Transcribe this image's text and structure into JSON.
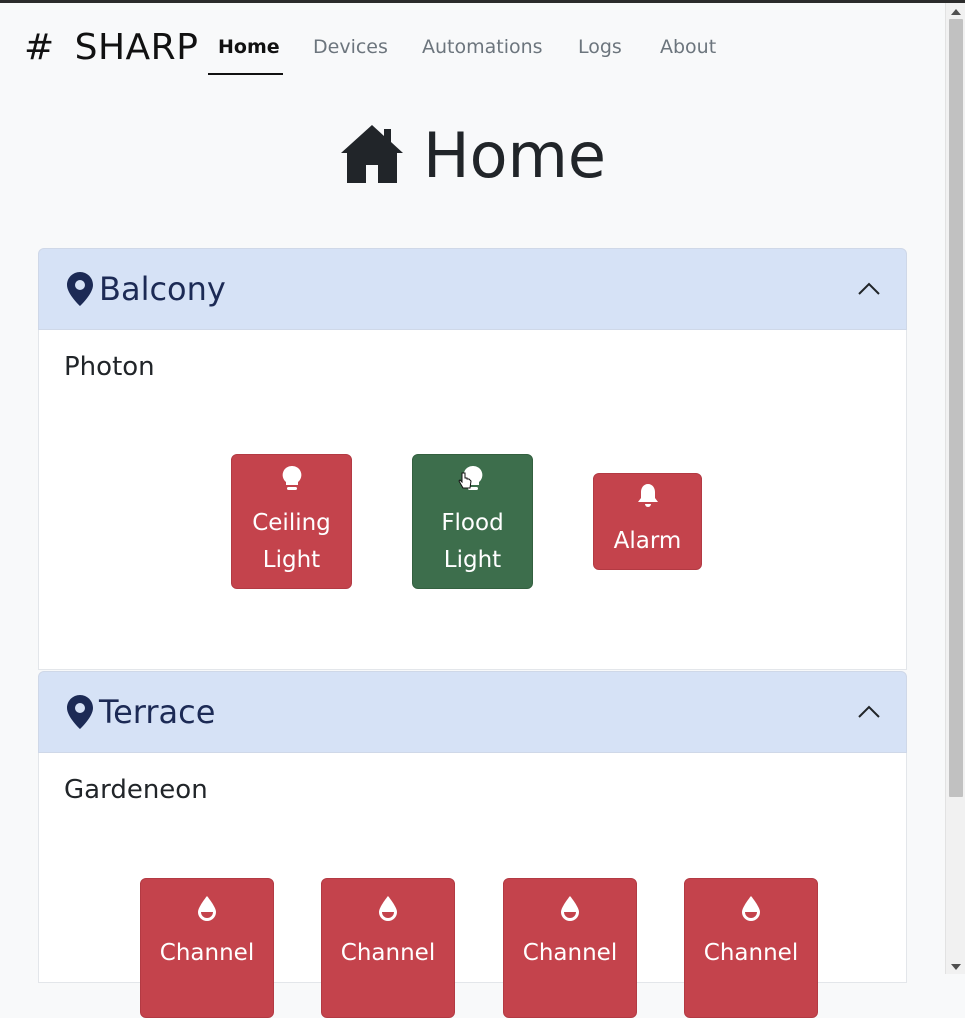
{
  "brand": {
    "symbol": "#",
    "name": "SHARP"
  },
  "nav": {
    "items": [
      {
        "label": "Home",
        "active": true
      },
      {
        "label": "Devices",
        "active": false
      },
      {
        "label": "Automations",
        "active": false
      },
      {
        "label": "Logs",
        "active": false
      },
      {
        "label": "About",
        "active": false
      }
    ]
  },
  "page": {
    "title": "Home",
    "icon": "house-icon"
  },
  "rooms": [
    {
      "name": "Balcony",
      "icon": "map-pin-icon",
      "expanded": true,
      "devices": [
        {
          "name": "Photon",
          "controls": [
            {
              "label": "Ceiling Light",
              "icon": "lightbulb-icon",
              "state": "off",
              "color": "#c4434c"
            },
            {
              "label": "Flood Light",
              "icon": "lightbulb-icon",
              "state": "on",
              "color": "#3d6e4c"
            },
            {
              "label": "Alarm",
              "icon": "bell-icon",
              "state": "off",
              "color": "#c4434c"
            }
          ]
        }
      ]
    },
    {
      "name": "Terrace",
      "icon": "map-pin-icon",
      "expanded": true,
      "devices": [
        {
          "name": "Gardeneon",
          "controls": [
            {
              "label": "Channel",
              "icon": "water-drop-icon",
              "state": "off",
              "color": "#c4434c"
            },
            {
              "label": "Channel",
              "icon": "water-drop-icon",
              "state": "off",
              "color": "#c4434c"
            },
            {
              "label": "Channel",
              "icon": "water-drop-icon",
              "state": "off",
              "color": "#c4434c"
            },
            {
              "label": "Channel",
              "icon": "water-drop-icon",
              "state": "off",
              "color": "#c4434c"
            }
          ]
        }
      ]
    }
  ],
  "colors": {
    "accent_off": "#c4434c",
    "accent_on": "#3d6e4c",
    "accordion_header": "#d6e2f6",
    "accordion_text": "#1c2a55"
  }
}
